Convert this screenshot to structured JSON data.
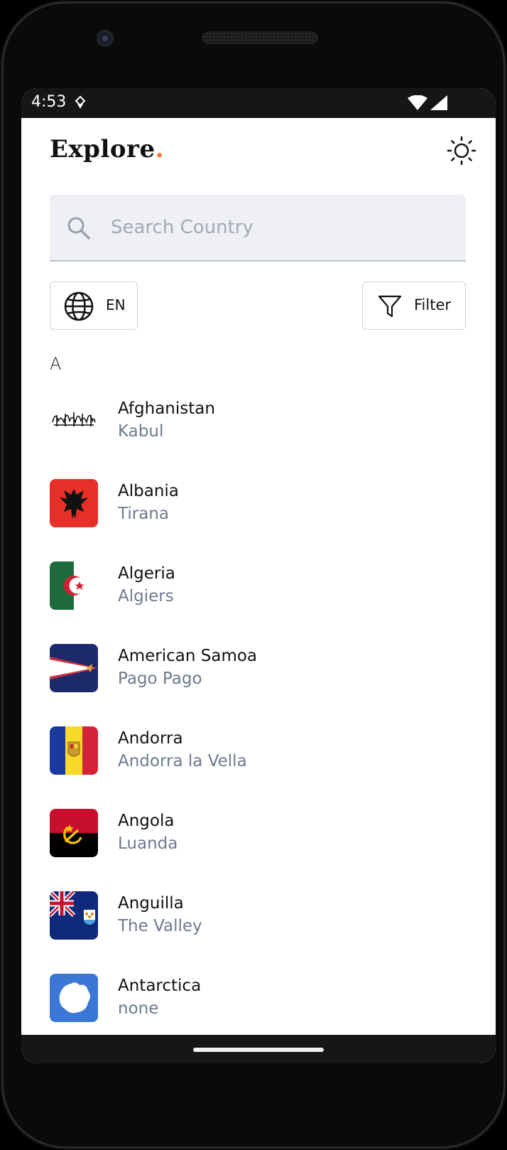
{
  "status_bar": {
    "time": "4:53"
  },
  "header": {
    "brand_text": "Explore",
    "brand_dot": ".",
    "accent_color": "#f0732a"
  },
  "search": {
    "placeholder": "Search Country",
    "value": ""
  },
  "toolbar": {
    "language_label": "EN",
    "filter_label": "Filter"
  },
  "list": {
    "section_letter": "A",
    "countries": [
      {
        "name": "Afghanistan",
        "capital": "Kabul",
        "flag": "afghanistan-flag"
      },
      {
        "name": "Albania",
        "capital": "Tirana",
        "flag": "albania-flag"
      },
      {
        "name": "Algeria",
        "capital": "Algiers",
        "flag": "algeria-flag"
      },
      {
        "name": "American Samoa",
        "capital": "Pago Pago",
        "flag": "american-samoa-flag"
      },
      {
        "name": "Andorra",
        "capital": "Andorra la Vella",
        "flag": "andorra-flag"
      },
      {
        "name": "Angola",
        "capital": "Luanda",
        "flag": "angola-flag"
      },
      {
        "name": "Anguilla",
        "capital": "The Valley",
        "flag": "anguilla-flag"
      },
      {
        "name": "Antarctica",
        "capital": "none",
        "flag": "antarctica-flag"
      }
    ]
  },
  "icons": {
    "theme": "sun-icon",
    "search": "search-icon",
    "language": "globe-icon",
    "filter": "funnel-icon"
  }
}
